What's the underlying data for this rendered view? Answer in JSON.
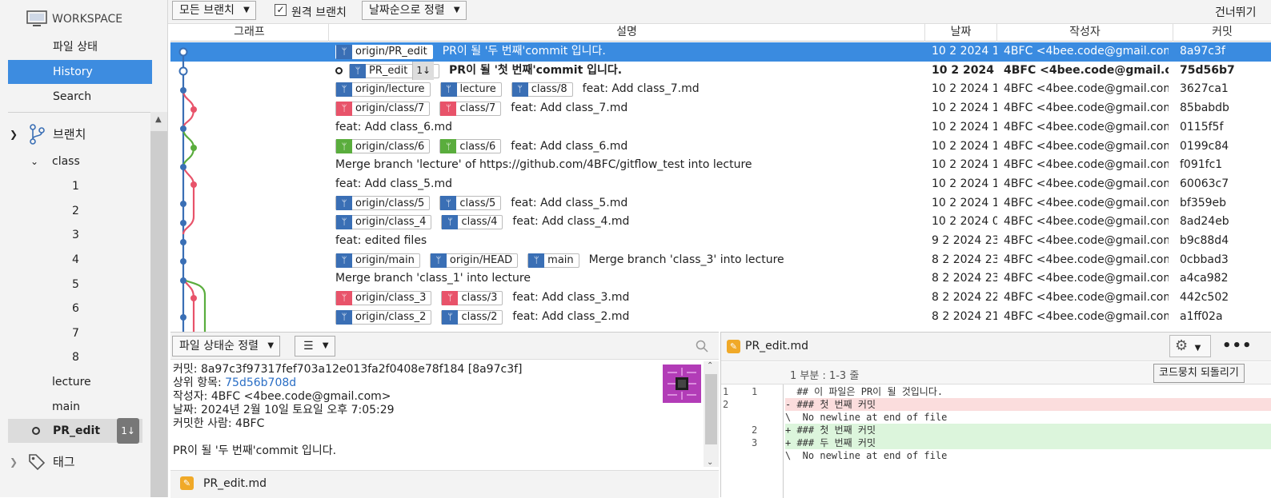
{
  "sidebar": {
    "workspace": "WORKSPACE",
    "nav": [
      {
        "label": "파일 상태"
      },
      {
        "label": "History"
      },
      {
        "label": "Search"
      }
    ],
    "branches_label": "브랜치",
    "class_label": "class",
    "class_items": [
      "1",
      "2",
      "3",
      "4",
      "5",
      "6",
      "7",
      "8"
    ],
    "lecture": "lecture",
    "main": "main",
    "pr_edit": "PR_edit",
    "pr_edit_badge": "1↓",
    "tags_label": "태그"
  },
  "toolbar": {
    "branch_filter": "모든 브랜치",
    "remote_checkbox": "원격 브랜치",
    "sort": "날짜순으로 정렬",
    "skip": "건너뛰기"
  },
  "columns": {
    "graph": "그래프",
    "desc": "설명",
    "date": "날짜",
    "author": "작성자",
    "commit": "커밋"
  },
  "commits": [
    {
      "tags": [
        {
          "name": "origin/PR_edit",
          "color": "#3a6fb5"
        }
      ],
      "msg": "PR이 될 '두 번째'commit 입니다.",
      "date": "10 2 2024 1",
      "author": "4BFC <4bee.code@gmail.com>",
      "hash": "8a97c3f",
      "selected": true
    },
    {
      "tags": [
        {
          "name": "PR_edit",
          "color": "#3a6fb5",
          "badge": "1↓"
        }
      ],
      "msg": "PR이 될 '첫 번째'commit 입니다.",
      "date": "10 2 2024",
      "author": "4BFC <4bee.code@gmail.com>",
      "hash": "75d56b7",
      "bold": true
    },
    {
      "tags": [
        {
          "name": "origin/lecture",
          "color": "#3a6fb5"
        },
        {
          "name": "lecture",
          "color": "#3a6fb5"
        },
        {
          "name": "class/8",
          "color": "#3a6fb5"
        }
      ],
      "msg": "feat: Add class_7.md",
      "date": "10 2 2024 1",
      "author": "4BFC <4bee.code@gmail.com>",
      "hash": "3627ca1"
    },
    {
      "tags": [
        {
          "name": "origin/class/7",
          "color": "#e8536a"
        },
        {
          "name": "class/7",
          "color": "#e8536a"
        }
      ],
      "msg": "feat: Add class_7.md",
      "date": "10 2 2024 1",
      "author": "4BFC <4bee.code@gmail.com>",
      "hash": "85babdb"
    },
    {
      "tags": [],
      "msg": "feat: Add class_6.md",
      "date": "10 2 2024 1",
      "author": "4BFC <4bee.code@gmail.com>",
      "hash": "0115f5f"
    },
    {
      "tags": [
        {
          "name": "origin/class/6",
          "color": "#5aad3d"
        },
        {
          "name": "class/6",
          "color": "#5aad3d"
        }
      ],
      "msg": "feat: Add class_6.md",
      "date": "10 2 2024 1",
      "author": "4BFC <4bee.code@gmail.com>",
      "hash": "0199c84"
    },
    {
      "tags": [],
      "msg": "Merge branch 'lecture' of https://github.com/4BFC/gitflow_test into lecture",
      "date": "10 2 2024 1",
      "author": "4BFC <4bee.code@gmail.com>",
      "hash": "f091fc1"
    },
    {
      "tags": [],
      "msg": "feat: Add class_5.md",
      "date": "10 2 2024 1",
      "author": "4BFC <4bee.code@gmail.com>",
      "hash": "60063c7"
    },
    {
      "tags": [
        {
          "name": "origin/class/5",
          "color": "#3a6fb5"
        },
        {
          "name": "class/5",
          "color": "#3a6fb5"
        }
      ],
      "msg": "feat: Add class_5.md",
      "date": "10 2 2024 1",
      "author": "4BFC <4bee.code@gmail.com>",
      "hash": "bf359eb"
    },
    {
      "tags": [
        {
          "name": "origin/class_4",
          "color": "#3a6fb5"
        },
        {
          "name": "class/4",
          "color": "#3a6fb5"
        }
      ],
      "msg": "feat: Add class_4.md",
      "date": "10 2 2024 0",
      "author": "4BFC <4bee.code@gmail.com>",
      "hash": "8ad24eb"
    },
    {
      "tags": [],
      "msg": "feat: edited files",
      "date": "9 2 2024 23",
      "author": "4BFC <4bee.code@gmail.com>",
      "hash": "b9c88d4"
    },
    {
      "tags": [
        {
          "name": "origin/main",
          "color": "#3a6fb5"
        },
        {
          "name": "origin/HEAD",
          "color": "#3a6fb5"
        },
        {
          "name": "main",
          "color": "#3a6fb5"
        }
      ],
      "msg": "Merge branch 'class_3' into lecture",
      "date": "8 2 2024 23",
      "author": "4BFC <4bee.code@gmail.com>",
      "hash": "0cbbad3"
    },
    {
      "tags": [],
      "msg": "Merge branch 'class_1' into lecture",
      "date": "8 2 2024 23",
      "author": "4BFC <4bee.code@gmail.com>",
      "hash": "a4ca982"
    },
    {
      "tags": [
        {
          "name": "origin/class_3",
          "color": "#e8536a"
        },
        {
          "name": "class/3",
          "color": "#e8536a"
        }
      ],
      "msg": "feat: Add class_3.md",
      "date": "8 2 2024 22",
      "author": "4BFC <4bee.code@gmail.com>",
      "hash": "442c502"
    },
    {
      "tags": [
        {
          "name": "origin/class_2",
          "color": "#3a6fb5"
        },
        {
          "name": "class/2",
          "color": "#3a6fb5"
        }
      ],
      "msg": "feat: Add class_2.md",
      "date": "8 2 2024 21",
      "author": "4BFC <4bee.code@gmail.com>",
      "hash": "a1ff02a"
    }
  ],
  "details": {
    "sort": "파일 상태순 정렬",
    "view_icon": "list-icon",
    "commit_label": "커밋:",
    "commit_value": "8a97c3f97317fef703a12e013fa2f0408e78f184 [8a97c3f]",
    "parent_label": "상위 항목:",
    "parent_value": "75d56b708d",
    "author_label": "작성자:",
    "author_value": "4BFC <4bee.code@gmail.com>",
    "date_label": "날짜:",
    "date_value": "2024년 2월 10일 토요일 오후 7:05:29",
    "committer_label": "커밋한 사람:",
    "committer_value": "4BFC",
    "message": "PR이 될 '두 번째'commit 입니다.",
    "file": "PR_edit.md"
  },
  "diff": {
    "file": "PR_edit.md",
    "hunk": "1 부분 : 1-3 줄",
    "revert": "코드뭉치 되돌리기",
    "lines": [
      {
        "type": "ctx",
        "n1": "1",
        "n2": "1",
        "text": "  ## 이 파일은 PR이 될 것입니다."
      },
      {
        "type": "del",
        "n1": "2",
        "n2": "",
        "text": "- ### 첫 번째 커밋"
      },
      {
        "type": "ctx",
        "n1": "",
        "n2": "",
        "text": "\\  No newline at end of file"
      },
      {
        "type": "add",
        "n1": "",
        "n2": "2",
        "text": "+ ### 첫 번째 커밋"
      },
      {
        "type": "add",
        "n1": "",
        "n2": "3",
        "text": "+ ### 두 번째 커밋"
      },
      {
        "type": "ctx",
        "n1": "",
        "n2": "",
        "text": "\\  No newline at end of file"
      }
    ]
  },
  "colors": {
    "accent": "#3a8be0",
    "blue": "#3a6fb5",
    "red": "#e8536a",
    "green": "#5aad3d"
  }
}
